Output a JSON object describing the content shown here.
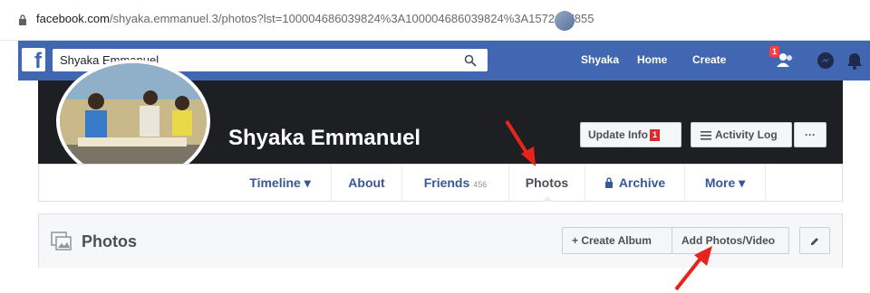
{
  "browser": {
    "url_host": "facebook.com",
    "url_rest": "/shyaka.emmanuel.3/photos?lst=100004686039824%3A100004686039824%3A1572167855"
  },
  "topbar": {
    "logo": "f",
    "search_value": "Shyaka Emmanuel",
    "user_name": "Shyaka",
    "home_label": "Home",
    "create_label": "Create",
    "friend_requests_badge": "1"
  },
  "profile": {
    "name": "Shyaka Emmanuel",
    "update_info_label": "Update Info",
    "update_info_badge": "1",
    "activity_log_label": "Activity Log",
    "more_options_label": "···"
  },
  "tabs": [
    {
      "label": "Timeline ▾"
    },
    {
      "label": "About"
    },
    {
      "label": "Friends",
      "count": "456"
    },
    {
      "label": "Photos"
    },
    {
      "label": "Archive"
    },
    {
      "label": "More ▾"
    }
  ],
  "photos_section": {
    "title": "Photos",
    "create_album_label": "+ Create Album",
    "add_photos_label": "Add Photos/Video"
  },
  "colors": {
    "fb_blue": "#4267b2",
    "link_blue": "#365899",
    "annotation_red": "#e8231b"
  }
}
